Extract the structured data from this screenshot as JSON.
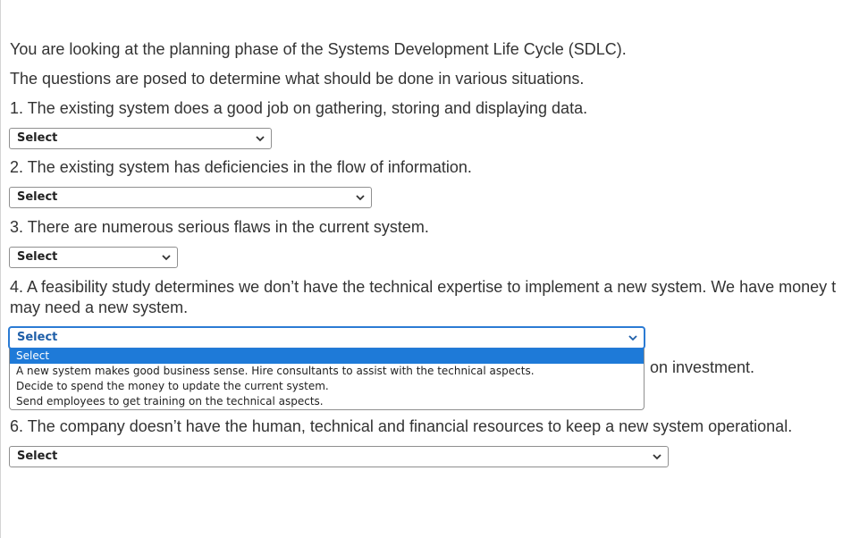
{
  "intro": {
    "line1": "You are looking at the planning phase of the Systems Development Life Cycle (SDLC).",
    "line2": "The questions are posed to determine what should be done in various situations."
  },
  "questions": [
    {
      "text": "1. The existing system does a good job on gathering, storing and displaying data.",
      "selected": "Select"
    },
    {
      "text": "2. The existing system has deficiencies in the flow of information.",
      "selected": "Select"
    },
    {
      "text": "3. There are numerous serious flaws in the current system.",
      "selected": "Select"
    },
    {
      "text_line1": "4. A feasibility study determines we don’t have the technical expertise to implement a new system. We have money t",
      "text_line2": "may need a new system.",
      "selected": "Select"
    },
    {
      "text_visible_tail": "on investment.",
      "selected": "Select"
    },
    {
      "text": "6. The company doesn’t have the human, technical and financial resources to keep a new system operational.",
      "selected": "Select"
    }
  ],
  "dropdown_options": [
    "Select",
    "A new system makes good business sense. Hire consultants to assist with the technical aspects.",
    "Decide to spend the money to update the current system.",
    "Send employees to get training on the technical aspects."
  ],
  "colors": {
    "focus_border": "#2b7bd4",
    "highlight_bg": "#1e7ad8",
    "text": "#333333"
  },
  "icons": {
    "select_arrow": "chevron-down-icon"
  }
}
